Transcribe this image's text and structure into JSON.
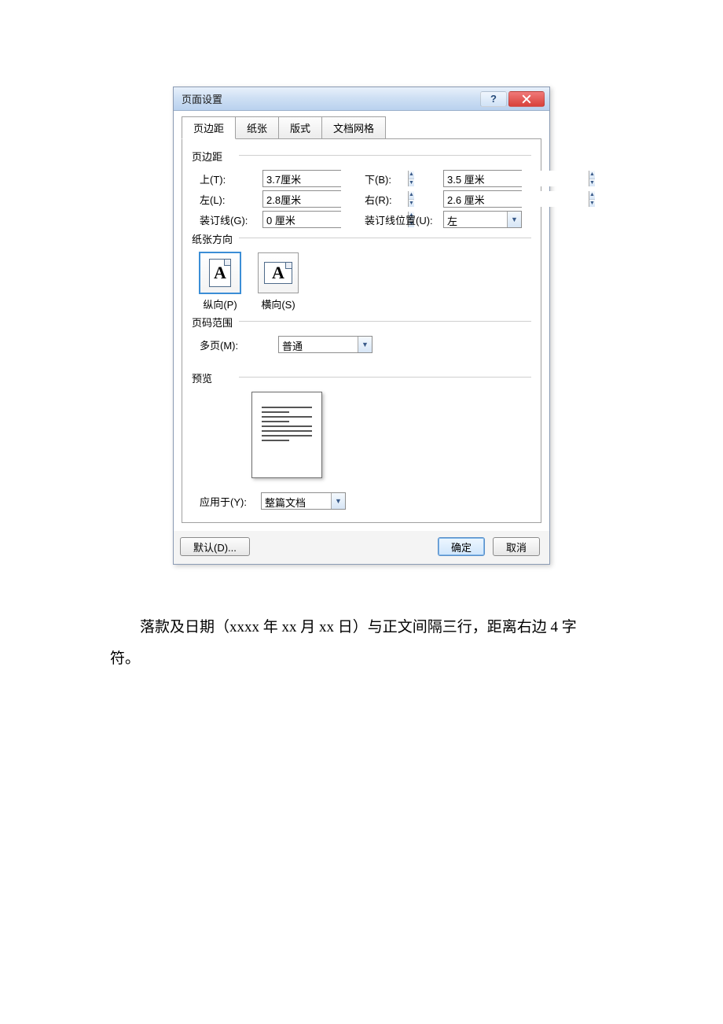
{
  "dialog": {
    "title": "页面设置",
    "close_symbol": "✕",
    "help_symbol": "?",
    "tabs": [
      "页边距",
      "纸张",
      "版式",
      "文档网格"
    ],
    "active_tab": 0,
    "groups": {
      "margins_label": "页边距",
      "orientation_label": "纸张方向",
      "page_range_label": "页码范围",
      "preview_label": "预览"
    },
    "margins": {
      "top_label": "上(T):",
      "top_value": "3.7厘米",
      "bottom_label": "下(B):",
      "bottom_value": "3.5 厘米",
      "left_label": "左(L):",
      "left_value": "2.8厘米",
      "right_label": "右(R):",
      "right_value": "2.6 厘米",
      "gutter_label": "装订线(G):",
      "gutter_value": "0 厘米",
      "gutter_pos_label": "装订线位置(U):",
      "gutter_pos_value": "左"
    },
    "orientation": {
      "portrait_label": "纵向(P)",
      "landscape_label": "横向(S)",
      "selected": "portrait"
    },
    "page_range": {
      "multi_label": "多页(M):",
      "multi_value": "普通"
    },
    "apply_to": {
      "label": "应用于(Y):",
      "value": "整篇文档"
    },
    "buttons": {
      "default": "默认(D)...",
      "ok": "确定",
      "cancel": "取消"
    }
  },
  "doc_text": "落款及日期（xxxx 年 xx 月 xx 日）与正文间隔三行，距离右边 4 字符。"
}
